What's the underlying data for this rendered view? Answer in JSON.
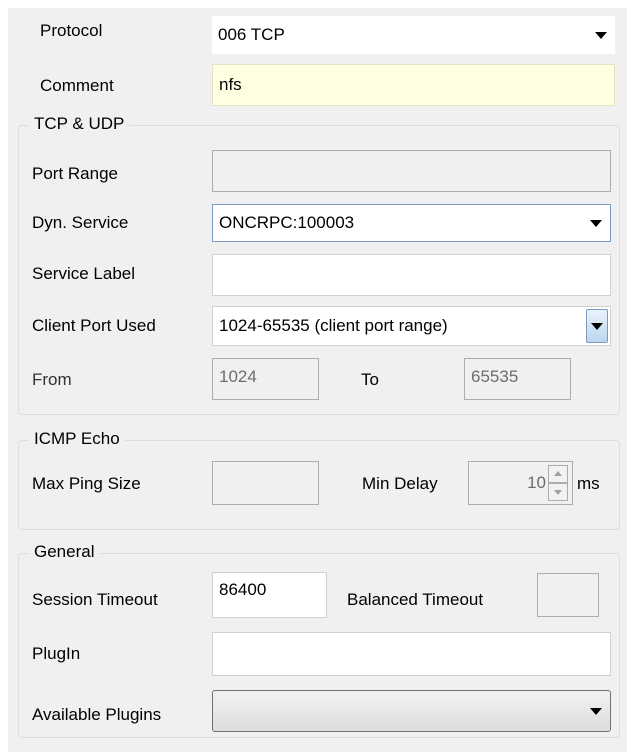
{
  "protocol": {
    "label": "Protocol",
    "value": "006 TCP"
  },
  "comment": {
    "label": "Comment",
    "value": "nfs"
  },
  "tcp_udp": {
    "title": "TCP & UDP",
    "port_range": {
      "label": "Port Range",
      "value": ""
    },
    "dyn_service": {
      "label": "Dyn. Service",
      "value": "ONCRPC:100003"
    },
    "service_label": {
      "label": "Service Label",
      "value": ""
    },
    "client_port": {
      "label": "Client Port Used",
      "value": "1024-65535 (client port range)"
    },
    "from": {
      "label": "From",
      "value": "1024"
    },
    "to": {
      "label": "To",
      "value": "65535"
    }
  },
  "icmp": {
    "title": "ICMP Echo",
    "max_ping": {
      "label": "Max Ping Size",
      "value": ""
    },
    "min_delay": {
      "label": "Min Delay",
      "value": "10",
      "unit": "ms"
    }
  },
  "general": {
    "title": "General",
    "session_timeout": {
      "label": "Session Timeout",
      "value": "86400"
    },
    "balanced_timeout": {
      "label": "Balanced Timeout",
      "value": ""
    },
    "plugin": {
      "label": "PlugIn",
      "value": ""
    },
    "available_plugins": {
      "label": "Available Plugins",
      "value": ""
    }
  },
  "icons": {
    "dropdown": "chevron-down-icon",
    "spinner_up": "chevron-up-icon",
    "spinner_down": "chevron-down-icon"
  },
  "colors": {
    "panel_bg": "#f0f0f0",
    "comment_bg": "#ffffe1",
    "group_border": "#d5dfe5",
    "dropdown_button": "#bcd5ee"
  }
}
